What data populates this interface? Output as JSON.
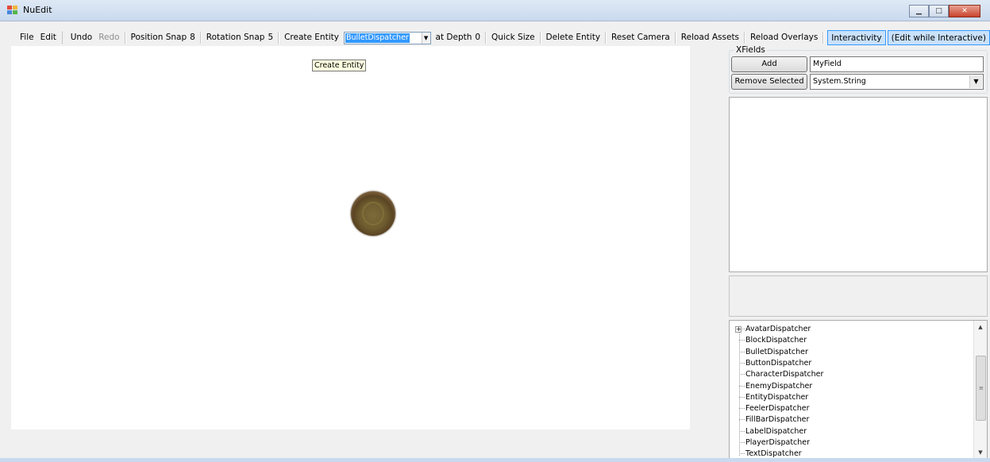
{
  "window": {
    "title": "NuEdit"
  },
  "menu": {
    "file": "File",
    "edit": "Edit"
  },
  "toolbar": {
    "undo": "Undo",
    "redo": "Redo",
    "position_snap_label": "Position Snap",
    "position_snap_value": "8",
    "rotation_snap_label": "Rotation Snap",
    "rotation_snap_value": "5",
    "create_entity": "Create Entity",
    "entity_type": "BulletDispatcher",
    "at_depth_label": "at Depth",
    "at_depth_value": "0",
    "quick_size": "Quick Size",
    "delete_entity": "Delete Entity",
    "reset_camera": "Reset Camera",
    "reload_assets": "Reload Assets",
    "reload_overlays": "Reload Overlays",
    "interactivity": "Interactivity",
    "edit_while_interactive": "(Edit while Interactive)"
  },
  "tooltip": {
    "text": "Create Entity"
  },
  "xfields": {
    "group_title": "XFields",
    "add_button": "Add",
    "field_name": "MyField",
    "remove_button": "Remove Selected",
    "field_type": "System.String"
  },
  "tree": {
    "items": [
      {
        "label": "AvatarDispatcher",
        "expandable": true
      },
      {
        "label": "BlockDispatcher"
      },
      {
        "label": "BulletDispatcher"
      },
      {
        "label": "ButtonDispatcher"
      },
      {
        "label": "CharacterDispatcher"
      },
      {
        "label": "EnemyDispatcher"
      },
      {
        "label": "EntityDispatcher"
      },
      {
        "label": "FeelerDispatcher"
      },
      {
        "label": "FillBarDispatcher"
      },
      {
        "label": "LabelDispatcher"
      },
      {
        "label": "PlayerDispatcher"
      },
      {
        "label": "TextDispatcher"
      }
    ]
  },
  "colors": {
    "selection": "#3399ff",
    "checked_bg": "#c9e1fb",
    "tooltip_bg": "#ffffe1"
  }
}
